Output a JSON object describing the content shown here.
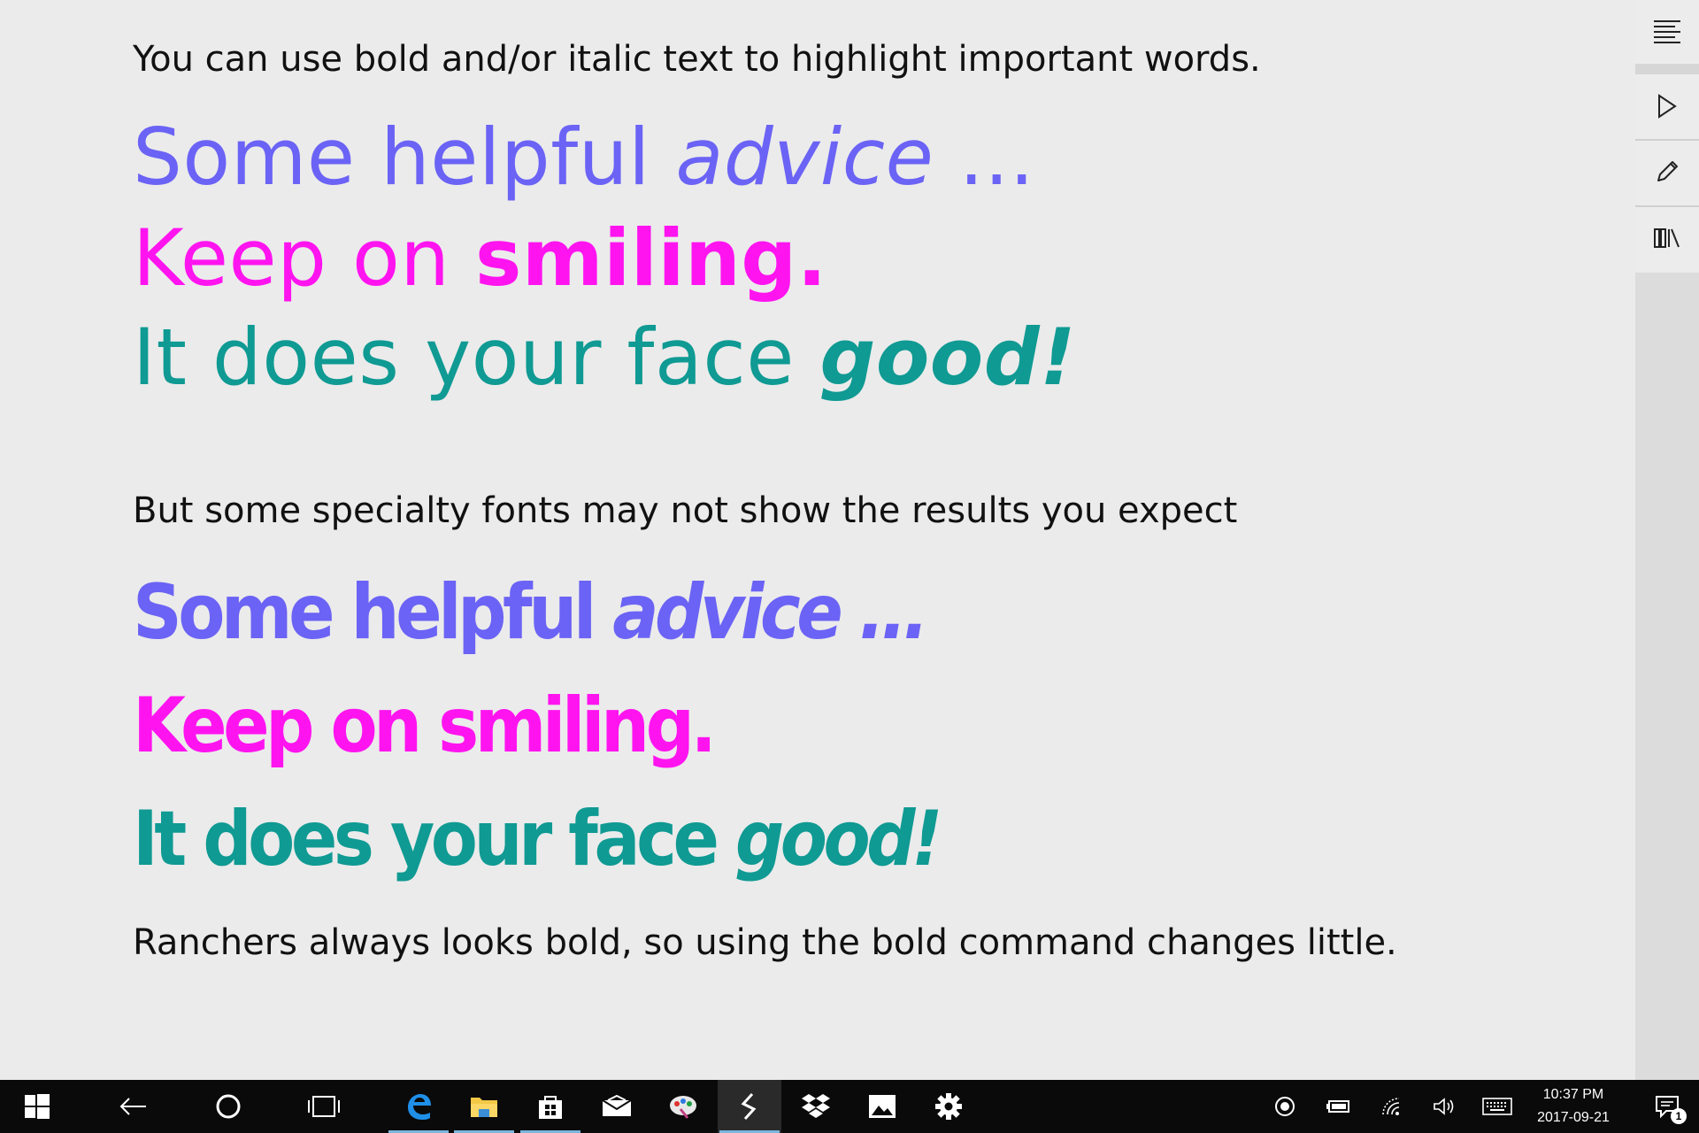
{
  "document": {
    "intro": "You can use bold and/or italic text to highlight important words.",
    "set1": {
      "line1": {
        "normal": "Some helpful ",
        "italic": "advice",
        "tail": " ..."
      },
      "line2": {
        "normal": "Keep on ",
        "bold": "smiling."
      },
      "line3": {
        "normal": "It does your face ",
        "bold_italic": "good!"
      }
    },
    "specialty_note": "But some specialty fonts may not show the results you expect",
    "set2": {
      "line1": {
        "normal": "Some helpful ",
        "italic": "advice",
        "tail": " ..."
      },
      "line2": {
        "normal": "Keep on smiling."
      },
      "line3": {
        "normal": "It does your face ",
        "italic": "good!"
      }
    },
    "ranchers_note": "Ranchers always looks bold, so using the bold command changes little."
  },
  "colors": {
    "violet": "#6b63f5",
    "magenta": "#ff14f0",
    "teal": "#0f9a93"
  },
  "rightbar": {
    "buttons": [
      {
        "icon": "menu-lines-icon"
      },
      {
        "icon": "play-icon"
      },
      {
        "icon": "pencil-icon"
      },
      {
        "icon": "library-icon"
      }
    ]
  },
  "taskbar": {
    "apps": [
      {
        "icon": "windows-start-icon"
      },
      {
        "icon": "back-arrow-icon"
      },
      {
        "icon": "cortana-circle-icon"
      },
      {
        "icon": "task-view-icon"
      },
      {
        "icon": "edge-icon"
      },
      {
        "icon": "file-explorer-icon"
      },
      {
        "icon": "store-icon"
      },
      {
        "icon": "mail-icon"
      },
      {
        "icon": "paint-icon"
      },
      {
        "icon": "sway-icon"
      },
      {
        "icon": "dropbox-icon"
      },
      {
        "icon": "photos-icon"
      },
      {
        "icon": "settings-gear-icon"
      }
    ],
    "tray": [
      {
        "icon": "record-icon"
      },
      {
        "icon": "battery-icon"
      },
      {
        "icon": "wifi-icon"
      },
      {
        "icon": "volume-icon"
      },
      {
        "icon": "keyboard-icon"
      }
    ],
    "clock": {
      "time": "10:37 PM",
      "date": "2017-09-21"
    },
    "notifications": {
      "count": "1"
    }
  }
}
